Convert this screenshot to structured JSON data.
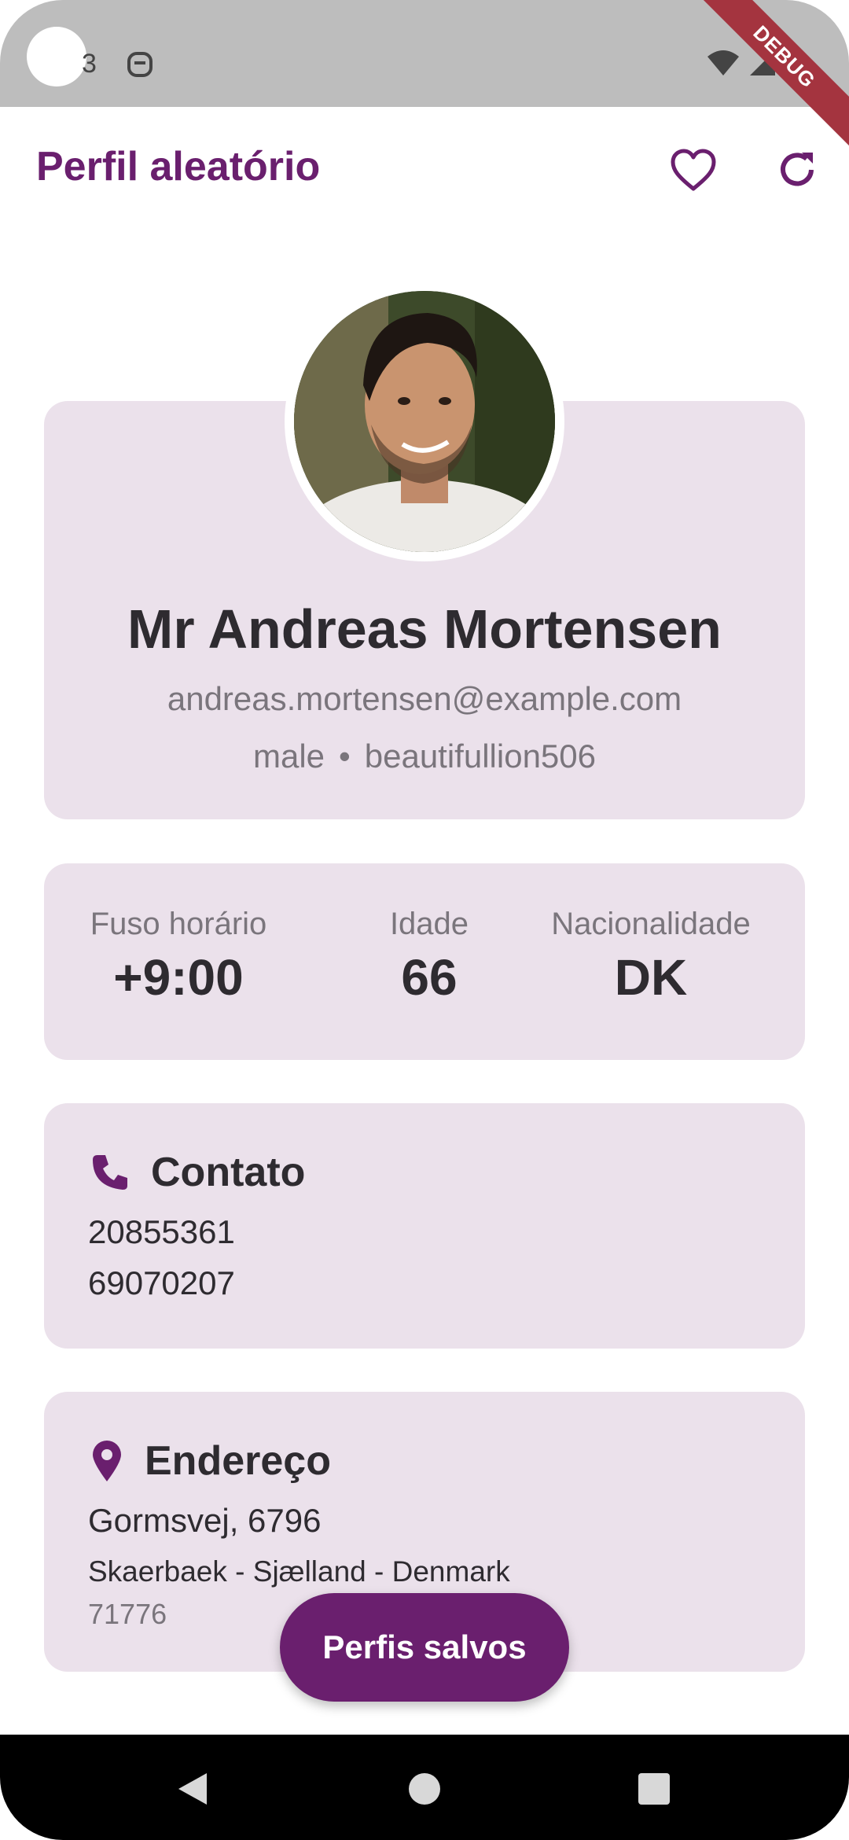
{
  "status_bar": {
    "time_fragment": "3",
    "debug_label": "DEBUG"
  },
  "app_bar": {
    "title": "Perfil aleatório",
    "favorite_icon": "heart-outline-icon",
    "refresh_icon": "refresh-icon"
  },
  "profile": {
    "full_name": "Mr Andreas Mortensen",
    "email": "andreas.mortensen@example.com",
    "gender": "male",
    "separator": "•",
    "username": "beautifullion506"
  },
  "stats": [
    {
      "label": "Fuso horário",
      "value": "+9:00"
    },
    {
      "label": "Idade",
      "value": "66"
    },
    {
      "label": "Nacionalidade",
      "value": "DK"
    }
  ],
  "contact": {
    "icon": "phone-icon",
    "title": "Contato",
    "phones": [
      "20855361",
      "69070207"
    ]
  },
  "address": {
    "icon": "location-pin-icon",
    "title": "Endereço",
    "street": "Gormsvej, 6796",
    "city_line": "Skaerbaek - Sjælland - Denmark",
    "postcode": "71776"
  },
  "fab": {
    "label": "Perfis salvos"
  },
  "colors": {
    "accent": "#6a1f6e",
    "card": "#ebe1eb",
    "status_bar": "#bdbdbd",
    "debug_banner": "#a4343f"
  }
}
